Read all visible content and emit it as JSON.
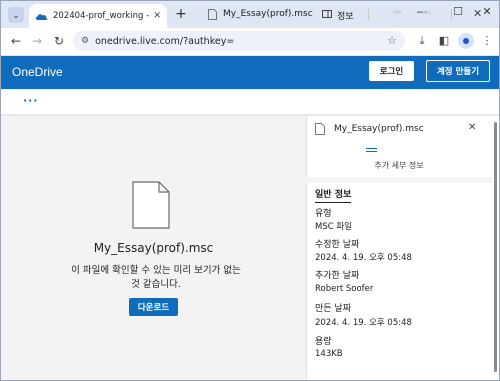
{
  "browser": {
    "tab_title": "202404-prof_working - OneDri",
    "url_main": "onedrive.live.com/?authkey=",
    "url_rest": ""
  },
  "header": {
    "brand": "OneDrive",
    "login_label": "로그인",
    "signup_label": "계정 만들기",
    "brand_color": "#0f6cbd"
  },
  "commandbar": {
    "more_label": "···",
    "filename": "My_Essay(prof).msc",
    "info_label": "정보"
  },
  "preview": {
    "filename": "My_Essay(prof).msc",
    "message": "이 파일에 확인할 수 있는 미리 보기가 없는 것 같습니다.",
    "download_label": "다운로드"
  },
  "details": {
    "filename": "My_Essay(prof).msc",
    "more_details": "추가 세부 정보",
    "section_title": "일반 정보",
    "fields": [
      {
        "label": "유형",
        "value": "MSC 파일"
      },
      {
        "label": "수정한 날짜",
        "value": "2024. 4. 19. 오후 05:48"
      },
      {
        "label": "추가한 날짜",
        "value": "Robert Soofer"
      },
      {
        "label": "만든 날짜",
        "value": "2024. 4. 19. 오후 05:48"
      },
      {
        "label": "용량",
        "value": "143KB"
      }
    ]
  },
  "icons": {
    "tab_dropdown": "chevron-down-icon",
    "close": "close-icon",
    "back": "back-arrow-icon",
    "forward": "forward-arrow-icon",
    "reload": "reload-icon",
    "bookmark": "star-icon",
    "download": "download-icon",
    "file": "file-icon",
    "info": "info-panel-icon"
  }
}
